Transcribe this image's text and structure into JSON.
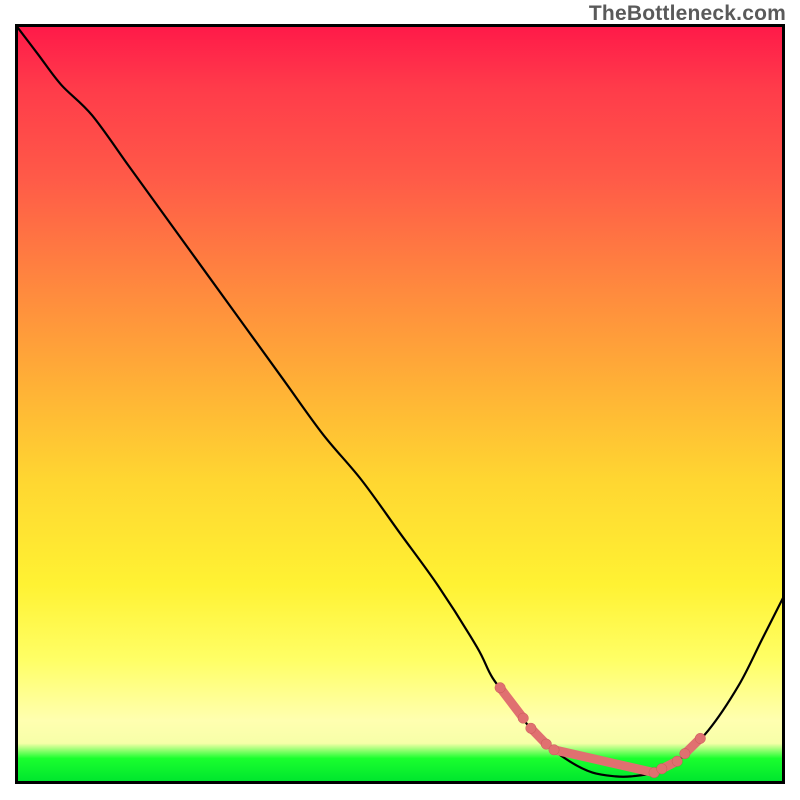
{
  "watermark": "TheBottleneck.com",
  "chart_data": {
    "type": "line",
    "title": "",
    "xlabel": "",
    "ylabel": "",
    "xlim": [
      0,
      100
    ],
    "ylim": [
      0,
      100
    ],
    "grid": false,
    "series": [
      {
        "name": "curve",
        "x": [
          0,
          3,
          6,
          10,
          15,
          20,
          25,
          30,
          35,
          40,
          45,
          50,
          55,
          60,
          62,
          65,
          68,
          72,
          75,
          78,
          80,
          83,
          86,
          90,
          94,
          97,
          100
        ],
        "y": [
          100,
          96,
          92,
          88,
          81,
          74,
          67,
          60,
          53,
          46,
          40,
          33,
          26,
          18,
          14,
          10,
          6,
          3,
          1.5,
          1,
          1,
          1.5,
          3,
          7,
          13,
          19,
          25
        ]
      }
    ],
    "highlight_segments": [
      {
        "x0": 63,
        "x1": 66
      },
      {
        "x0": 67,
        "x1": 69
      },
      {
        "x0": 70,
        "x1": 83
      },
      {
        "x0": 84,
        "x1": 86
      },
      {
        "x0": 87,
        "x1": 89
      }
    ]
  }
}
